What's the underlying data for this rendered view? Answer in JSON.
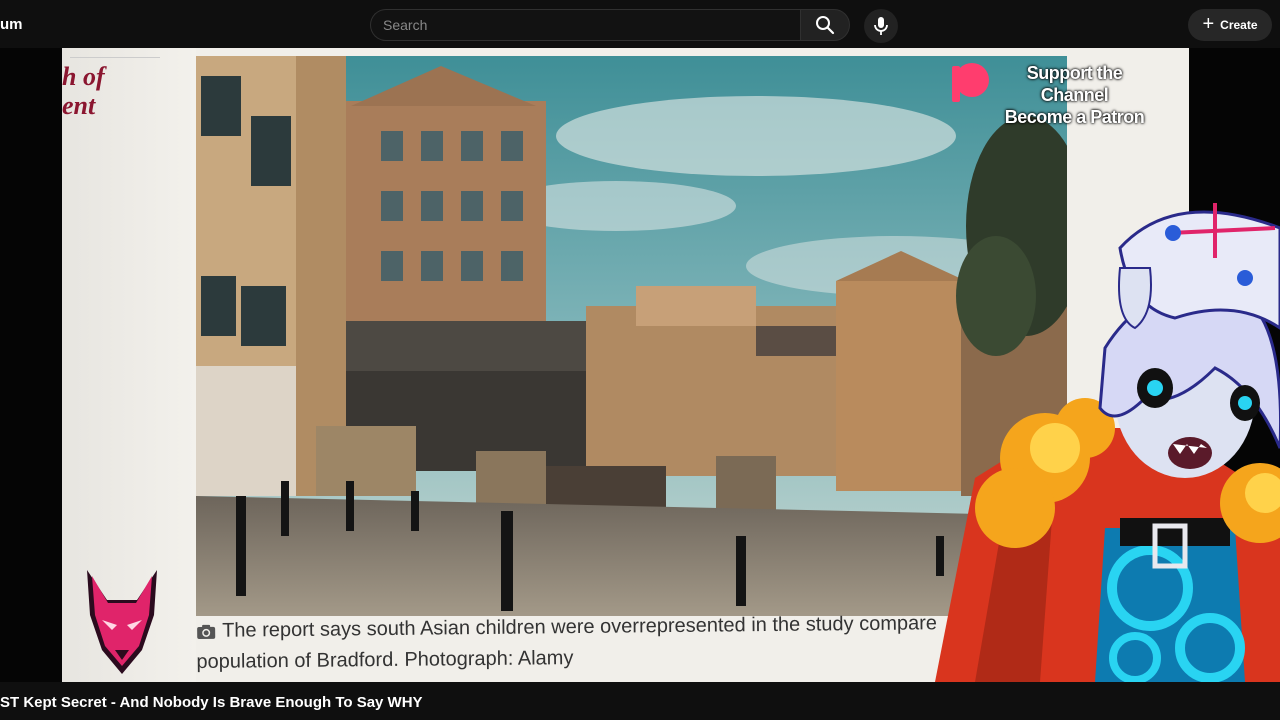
{
  "header": {
    "brand_fragment": "um",
    "search_placeholder": "Search",
    "search_value": "",
    "create_label": "Create",
    "icons": {
      "search": "search-icon",
      "mic": "microphone-icon",
      "create": "plus-icon"
    }
  },
  "video": {
    "headline_fragment_line1": "h of",
    "headline_fragment_line2": "ent",
    "caption": "The report says south Asian children were overrepresented in the study compare",
    "caption_line2": "population of Bradford. Photograph: Alamy",
    "overlay": {
      "patreon_line1": "Support the Channel",
      "patreon_line2": "Become a Patron"
    },
    "title": "ST Kept Secret - And Nobody Is Brave Enough To Say WHY"
  },
  "colors": {
    "background": "#0f0f0f",
    "headline_red": "#8b1630",
    "patreon_pink": "#ff3d6e"
  }
}
